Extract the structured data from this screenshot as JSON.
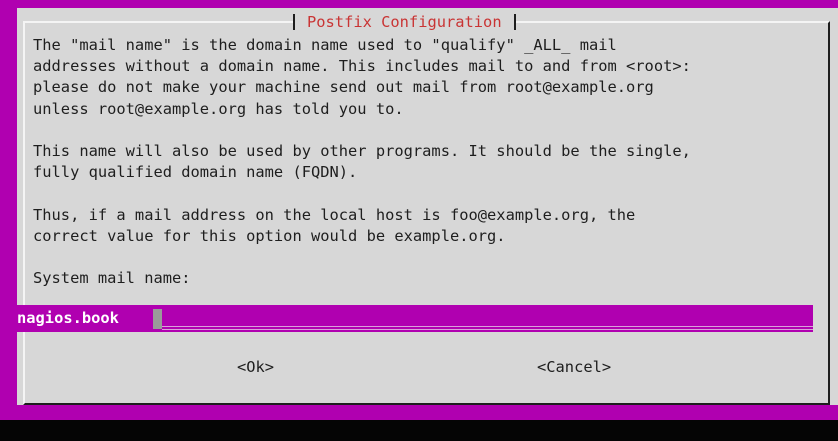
{
  "dialog": {
    "title": "Postfix Configuration",
    "paragraphs": [
      "The \"mail name\" is the domain name used to \"qualify\" _ALL_ mail\naddresses without a domain name. This includes mail to and from <root>:\nplease do not make your machine send out mail from root@example.org\nunless root@example.org has told you to.",
      "This name will also be used by other programs. It should be the single,\nfully qualified domain name (FQDN).",
      "Thus, if a mail address on the local host is foo@example.org, the\ncorrect value for this option would be example.org."
    ],
    "field_label": "System mail name:",
    "field_value": "nagios.book",
    "ok_button": "<Ok>",
    "cancel_button": "<Cancel>"
  },
  "colors": {
    "terminal_background": "#b000b0",
    "dialog_background": "#d7d7d7",
    "title_color": "#c93434",
    "input_highlight": "#b000b0"
  }
}
